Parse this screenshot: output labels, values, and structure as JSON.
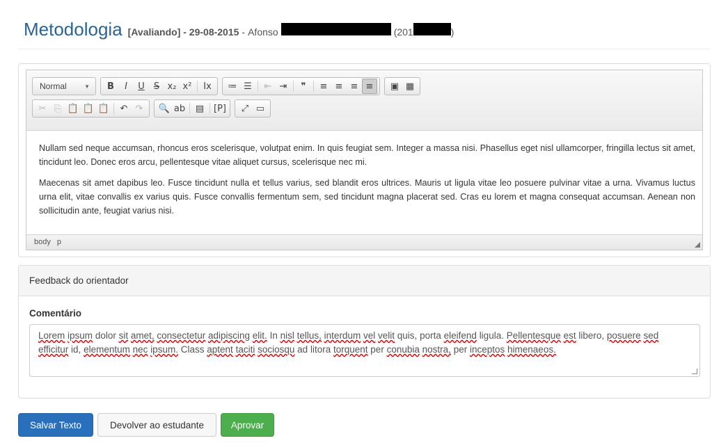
{
  "page": {
    "title": "Metodologia",
    "status": "[Avaliando] - 29-08-2015",
    "separator": "-",
    "author_prefix": "Afonso",
    "author_paren_open": "(201",
    "author_paren_close": ")"
  },
  "editor": {
    "format_combo": "Normal",
    "toolbar_row1": [
      {
        "icon": "bold-icon",
        "glyph": "B"
      },
      {
        "icon": "italic-icon",
        "glyph": "I"
      },
      {
        "icon": "underline-icon",
        "glyph": "U"
      },
      {
        "icon": "strike-icon",
        "glyph": "S"
      },
      {
        "icon": "subscript-icon",
        "glyph": "x₂"
      },
      {
        "icon": "superscript-icon",
        "glyph": "x²"
      },
      {
        "icon": "remove-format-icon",
        "glyph": "Ix"
      },
      {
        "icon": "numbered-list-icon",
        "glyph": "≔"
      },
      {
        "icon": "bulleted-list-icon",
        "glyph": "☰"
      },
      {
        "icon": "outdent-icon",
        "glyph": "⇤"
      },
      {
        "icon": "indent-icon",
        "glyph": "⇥"
      },
      {
        "icon": "blockquote-icon",
        "glyph": "❞"
      },
      {
        "icon": "align-left-icon",
        "glyph": "≡"
      },
      {
        "icon": "align-center-icon",
        "glyph": "≡"
      },
      {
        "icon": "align-right-icon",
        "glyph": "≡"
      },
      {
        "icon": "justify-icon",
        "glyph": "≡"
      },
      {
        "icon": "image-icon",
        "glyph": "▣"
      },
      {
        "icon": "table-icon",
        "glyph": "▦"
      }
    ],
    "toolbar_row2": [
      {
        "icon": "cut-icon",
        "glyph": "✂"
      },
      {
        "icon": "copy-icon",
        "glyph": "⎘"
      },
      {
        "icon": "paste-icon",
        "glyph": "📋"
      },
      {
        "icon": "paste-text-icon",
        "glyph": "📋"
      },
      {
        "icon": "paste-word-icon",
        "glyph": "📋"
      },
      {
        "icon": "undo-icon",
        "glyph": "↶"
      },
      {
        "icon": "redo-icon",
        "glyph": "↷"
      },
      {
        "icon": "find-icon",
        "glyph": "🔍"
      },
      {
        "icon": "replace-icon",
        "glyph": "ab"
      },
      {
        "icon": "select-all-icon",
        "glyph": "▤"
      },
      {
        "icon": "show-blocks-icon",
        "glyph": "[P]"
      },
      {
        "icon": "maximize-icon",
        "glyph": "⤢"
      },
      {
        "icon": "source-icon",
        "glyph": "▭"
      }
    ],
    "paragraphs": [
      "Nullam sed neque accumsan, rhoncus eros scelerisque, volutpat enim. In quis feugiat sem. Integer a massa nisi. Phasellus eget nisl ullamcorper, fringilla lectus sit amet, tincidunt leo. Donec eros arcu, pellentesque vitae aliquet cursus, scelerisque nec mi.",
      "Maecenas sit amet dapibus leo. Fusce tincidunt nulla et tellus varius, sed blandit eros ultrices. Mauris ut ligula vitae leo posuere pulvinar vitae a urna. Vivamus luctus urna elit, vitae convallis ex varius quis. Fusce convallis fermentum sem, sed tincidunt magna placerat sed. Cras eu lorem et magna consequat accumsan. Aenean non sollicitudin ante, feugiat varius nisi."
    ],
    "path": [
      "body",
      "p"
    ]
  },
  "feedback": {
    "header": "Feedback do orientador",
    "label": "Comentário",
    "comment": "Lorem ipsum dolor sit amet, consectetur adipiscing elit. In nisl tellus, interdum vel velit quis, porta eleifend ligula. Pellentesque est libero, posuere sed efficitur id, elementum nec ipsum. Class aptent taciti sociosqu ad litora torquent per conubia nostra, per inceptos himenaeos."
  },
  "buttons": {
    "save": "Salvar Texto",
    "return": "Devolver ao estudante",
    "approve": "Aprovar"
  },
  "colors": {
    "title": "#2a6496",
    "save": "#2a6fbb",
    "approve": "#4cae4c"
  }
}
